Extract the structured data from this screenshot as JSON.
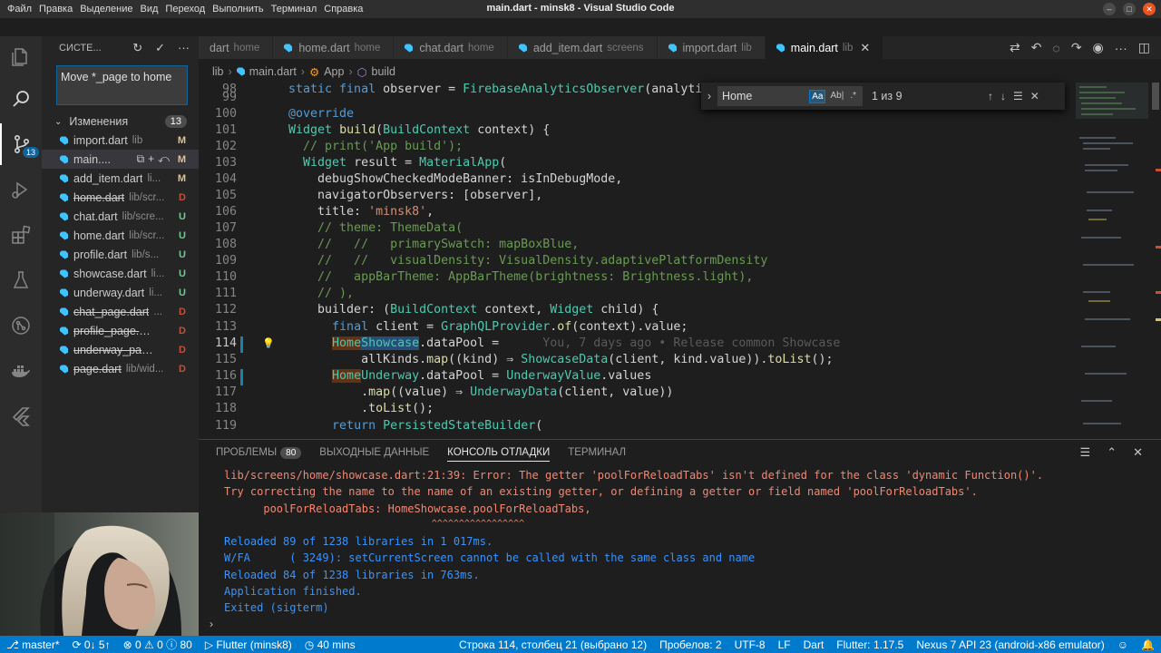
{
  "window": {
    "title": "main.dart - minsk8 - Visual Studio Code",
    "menu": [
      "Файл",
      "Правка",
      "Выделение",
      "Вид",
      "Переход",
      "Выполнить",
      "Терминал",
      "Справка"
    ]
  },
  "activity": {
    "scm_badge": "13"
  },
  "sidebar": {
    "title": "СИСТЕ...",
    "commit_message": "Move *_page to home",
    "changes_label": "Изменения",
    "changes_count": "13",
    "files": [
      {
        "name": "import.dart",
        "path": "lib",
        "status": "M",
        "deleted": false
      },
      {
        "name": "main....",
        "path": "",
        "status": "M",
        "deleted": false
      },
      {
        "name": "add_item.dart",
        "path": "li...",
        "status": "M",
        "deleted": false
      },
      {
        "name": "home.dart",
        "path": "lib/scr...",
        "status": "D",
        "deleted": true
      },
      {
        "name": "chat.dart",
        "path": "lib/scre...",
        "status": "U",
        "deleted": false
      },
      {
        "name": "home.dart",
        "path": "lib/scr...",
        "status": "U",
        "deleted": false
      },
      {
        "name": "profile.dart",
        "path": "lib/s...",
        "status": "U",
        "deleted": false
      },
      {
        "name": "showcase.dart",
        "path": "li...",
        "status": "U",
        "deleted": false
      },
      {
        "name": "underway.dart",
        "path": "li...",
        "status": "U",
        "deleted": false
      },
      {
        "name": "chat_page.dart",
        "path": "...",
        "status": "D",
        "deleted": true
      },
      {
        "name": "profile_page.dar...",
        "path": "",
        "status": "D",
        "deleted": true
      },
      {
        "name": "underway_page...",
        "path": "",
        "status": "D",
        "deleted": true
      },
      {
        "name": "page.dart",
        "path": "lib/wid...",
        "status": "D",
        "deleted": true
      }
    ]
  },
  "tabs": [
    {
      "name": "dart",
      "desc": "home"
    },
    {
      "name": "home.dart",
      "desc": "home"
    },
    {
      "name": "chat.dart",
      "desc": "home"
    },
    {
      "name": "add_item.dart",
      "desc": "screens"
    },
    {
      "name": "import.dart",
      "desc": "lib"
    },
    {
      "name": "main.dart",
      "desc": "lib"
    }
  ],
  "breadcrumb": [
    "lib",
    "main.dart",
    "App",
    "build"
  ],
  "find": {
    "query": "Home",
    "match_case": "Aa",
    "whole_word": "Ab|",
    "regex": ".*",
    "result": "1 из 9"
  },
  "editor": {
    "lines": [
      {
        "n": "98",
        "text": "  static final observer = FirebaseAnalyticsObserver(analytic"
      },
      {
        "n": "99",
        "text": ""
      },
      {
        "n": "100",
        "text": "  @override"
      },
      {
        "n": "101",
        "text": "  Widget build(BuildContext context) {"
      },
      {
        "n": "102",
        "text": "    // print('App build');"
      },
      {
        "n": "103",
        "text": "    Widget result = MaterialApp("
      },
      {
        "n": "104",
        "text": "      debugShowCheckedModeBanner: isInDebugMode,"
      },
      {
        "n": "105",
        "text": "      navigatorObservers: [observer],"
      },
      {
        "n": "106",
        "text": "      title: 'minsk8',"
      },
      {
        "n": "107",
        "text": "      // theme: ThemeData("
      },
      {
        "n": "108",
        "text": "      //   //   primarySwatch: mapBoxBlue,"
      },
      {
        "n": "109",
        "text": "      //   //   visualDensity: VisualDensity.adaptivePlatformDensity"
      },
      {
        "n": "110",
        "text": "      //   appBarTheme: AppBarTheme(brightness: Brightness.light),"
      },
      {
        "n": "111",
        "text": "      // ),"
      },
      {
        "n": "112",
        "text": "      builder: (BuildContext context, Widget child) {"
      },
      {
        "n": "113",
        "text": "        final client = GraphQLProvider.of(context).value;"
      },
      {
        "n": "114",
        "text": "        HomeShowcase.dataPool ="
      },
      {
        "n": "115",
        "text": "            allKinds.map((kind) ⇒ ShowcaseData(client, kind.value)).toList();"
      },
      {
        "n": "116",
        "text": "        HomeUnderway.dataPool = UnderwayValue.values"
      },
      {
        "n": "117",
        "text": "            .map((value) ⇒ UnderwayData(client, value))"
      },
      {
        "n": "118",
        "text": "            .toList();"
      },
      {
        "n": "119",
        "text": "        return PersistedStateBuilder("
      }
    ],
    "blame": "You, 7 days ago • Release common Showcase"
  },
  "panel": {
    "tabs": [
      {
        "label": "ПРОБЛЕМЫ",
        "badge": "80"
      },
      {
        "label": "ВЫХОДНЫЕ ДАННЫЕ",
        "badge": ""
      },
      {
        "label": "КОНСОЛЬ ОТЛАДКИ",
        "badge": ""
      },
      {
        "label": "ТЕРМИНАЛ",
        "badge": ""
      }
    ],
    "console": [
      {
        "text": "lib/screens/home/showcase.dart:21:39: Error: The getter 'poolForReloadTabs' isn't defined for the class 'dynamic Function()'.",
        "kind": "err"
      },
      {
        "text": "Try correcting the name to the name of an existing getter, or defining a getter or field named 'poolForReloadTabs'.",
        "kind": "err"
      },
      {
        "text": "      poolForReloadTabs: HomeShowcase.poolForReloadTabs,",
        "kind": "err"
      },
      {
        "text": "                                      ^^^^^^^^^^^^^^^^^",
        "kind": "err"
      },
      {
        "text": "Reloaded 89 of 1238 libraries in 1 017ms.",
        "kind": "info"
      },
      {
        "text": "W/FA      ( 3249): setCurrentScreen cannot be called with the same class and name",
        "kind": "info"
      },
      {
        "text": "Reloaded 84 of 1238 libraries in 763ms.",
        "kind": "info"
      },
      {
        "text": "Application finished.",
        "kind": "info"
      },
      {
        "text": "Exited (sigterm)",
        "kind": "info"
      }
    ]
  },
  "status": {
    "branch": "master*",
    "sync": "0↓ 5↑",
    "errors": "0",
    "warnings": "0",
    "infos": "80",
    "flutter": "Flutter (minsk8)",
    "time": "40 mins",
    "position": "Строка 114, столбец 21 (выбрано 12)",
    "spaces": "Пробелов: 2",
    "encoding": "UTF-8",
    "eol": "LF",
    "language": "Dart",
    "flutter_version": "Flutter: 1.17.5",
    "device": "Nexus 7 API 23 (android-x86 emulator)"
  },
  "colors": {
    "accent": "#007acc",
    "error_text": "#f48771",
    "info_text": "#3794ff"
  }
}
